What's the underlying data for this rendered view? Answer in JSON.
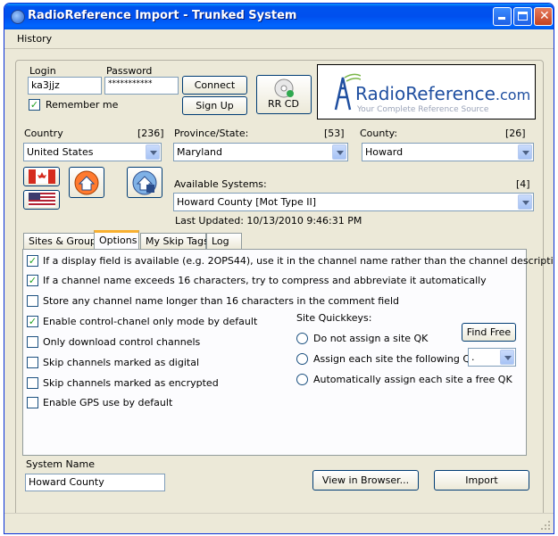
{
  "window": {
    "title": "RadioReference Import - Trunked System"
  },
  "menu": {
    "items": [
      "History"
    ]
  },
  "login": {
    "login_label": "Login",
    "login_value": "ka3jjz",
    "password_label": "Password",
    "password_value": "***********",
    "remember_label": "Remember me",
    "remember_checked": true,
    "connect_label": "Connect",
    "signup_label": "Sign Up",
    "rrcd_label": "RR CD"
  },
  "logo": {
    "brand_radio": "Radio",
    "brand_reference": "Reference",
    "brand_suffix": ".com",
    "tagline": "Your Complete Reference Source"
  },
  "location": {
    "country_label": "Country",
    "country_count": "[236]",
    "country_value": "United States",
    "state_label": "Province/State:",
    "state_count": "[53]",
    "state_value": "Maryland",
    "county_label": "County:",
    "county_count": "[26]",
    "county_value": "Howard"
  },
  "systems": {
    "available_label": "Available Systems:",
    "available_count": "[4]",
    "selected": "Howard County [Mot Type II]",
    "last_updated": "Last Updated: 10/13/2010 9:46:31 PM"
  },
  "tabs": [
    "Sites & Groups",
    "Options",
    "My Skip Tags",
    "Log"
  ],
  "options": {
    "checks": [
      {
        "label": "If a display field is available (e.g. 2OPS44), use it in the channel name rather than the channel description",
        "checked": true
      },
      {
        "label": "If a channel name exceeds 16 characters, try to compress and abbreviate it automatically",
        "checked": true
      },
      {
        "label": "Store any channel name longer than 16 characters in the comment field",
        "checked": false
      },
      {
        "label": "Enable control-chanel only mode by default",
        "checked": true
      },
      {
        "label": "Only download control channels",
        "checked": false
      },
      {
        "label": "Skip channels marked as digital",
        "checked": false
      },
      {
        "label": "Skip channels marked as encrypted",
        "checked": false
      },
      {
        "label": "Enable GPS use by default",
        "checked": false
      }
    ],
    "quickkeys": {
      "title": "Site Quickkeys:",
      "find_free_label": "Find Free",
      "radios": [
        "Do not assign a site QK",
        "Assign each site the following QK:",
        "Automatically assign each site a free QK"
      ],
      "qk_value": "."
    }
  },
  "bottom": {
    "system_name_label": "System Name",
    "system_name_value": "Howard County",
    "view_browser_label": "View in Browser...",
    "import_label": "Import"
  },
  "colors": {
    "title_blue": "#0053ee",
    "logo_blue": "#1f4fa0",
    "tab_highlight": "#f8b030"
  }
}
